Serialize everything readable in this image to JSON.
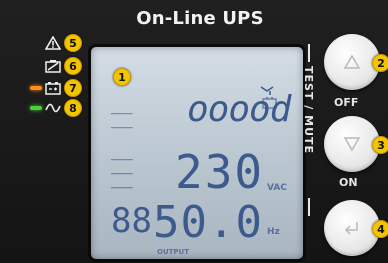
{
  "header": {
    "title": "On-Line UPS"
  },
  "indicators": [
    {
      "badge": "5",
      "icon": "warning-icon",
      "led": "off"
    },
    {
      "badge": "6",
      "icon": "battery-fault-icon",
      "led": "off"
    },
    {
      "badge": "7",
      "icon": "battery-icon",
      "led": "orange"
    },
    {
      "badge": "8",
      "icon": "ac-wave-icon",
      "led": "green"
    }
  ],
  "lcd": {
    "badge": "1",
    "row1": "ooood",
    "row2_value": "230",
    "row2_unit": "VAC",
    "row3_prefix": "88",
    "row3_value": "50.0",
    "row3_unit": "Hz",
    "bottom_label": "OUTPUT"
  },
  "buttons": [
    {
      "badge": "2",
      "icon": "triangle-up-icon"
    },
    {
      "badge": "3",
      "icon": "triangle-down-icon"
    },
    {
      "badge": "4",
      "icon": "enter-icon"
    }
  ],
  "labels": {
    "vertical": "TEST / MUTE",
    "off": "OFF",
    "on": "ON"
  },
  "colors": {
    "badge": "#f2c500",
    "lcd_segment": "#3c5a8c",
    "led_orange": "#ff8c1a",
    "led_green": "#48d23a"
  }
}
